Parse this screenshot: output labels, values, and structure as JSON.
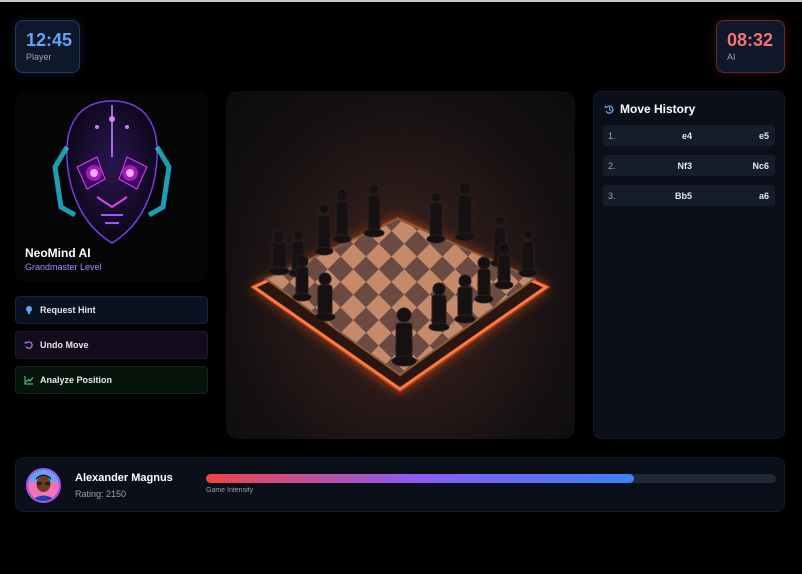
{
  "timers": {
    "player": {
      "time": "12:45",
      "label": "Player"
    },
    "ai": {
      "time": "08:32",
      "label": "AI"
    }
  },
  "opponent": {
    "name": "NeoMind AI",
    "level": "Grandmaster Level"
  },
  "actions": {
    "hint": "Request Hint",
    "undo": "Undo Move",
    "analyze": "Analyze Position"
  },
  "history": {
    "title": "Move History",
    "moves": [
      {
        "num": "1.",
        "white": "e4",
        "black": "e5"
      },
      {
        "num": "2.",
        "white": "Nf3",
        "black": "Nc6"
      },
      {
        "num": "3.",
        "white": "Bb5",
        "black": "a6"
      }
    ]
  },
  "player": {
    "name": "Alexander Magnus",
    "rating": "Rating: 2150"
  },
  "intensity": {
    "label": "Game Intensity",
    "level": 0.75
  },
  "colors": {
    "player_accent": "#60a5fa",
    "ai_accent": "#f87171",
    "purple_accent": "#a78bfa",
    "board_glow": "#ff5a1f"
  }
}
